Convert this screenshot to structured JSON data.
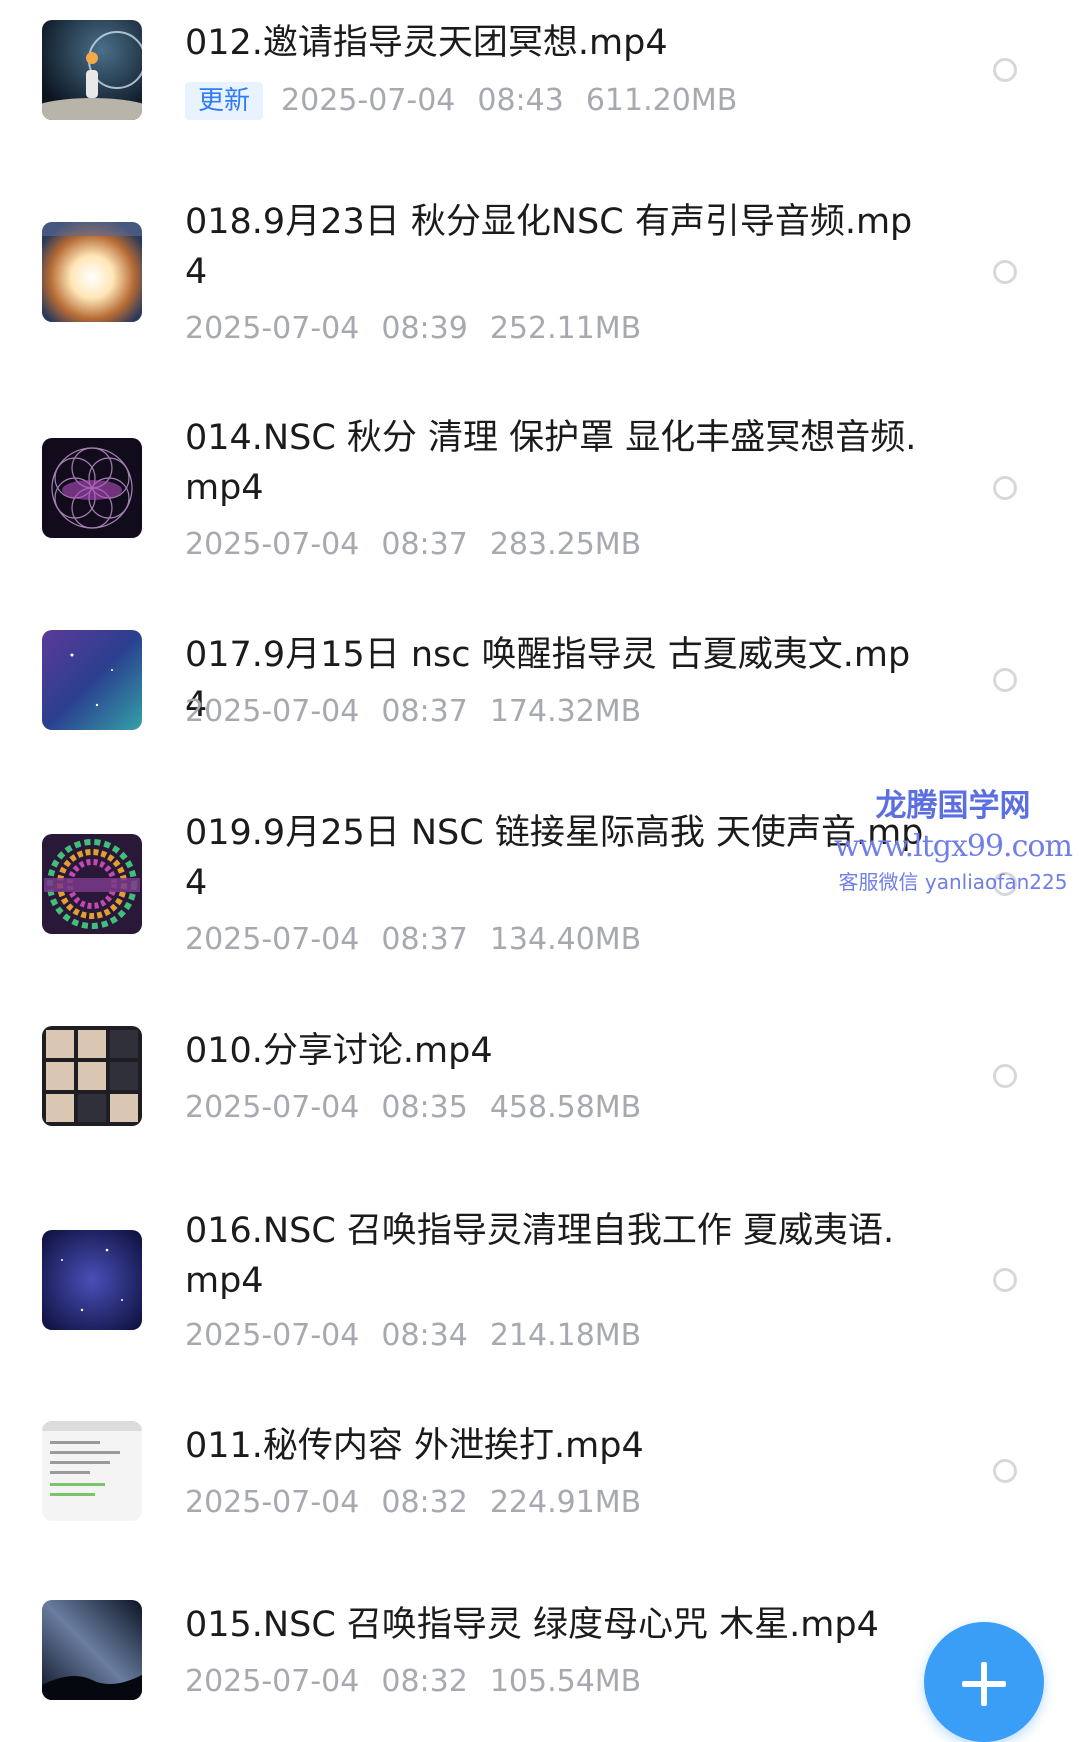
{
  "colors": {
    "accent": "#3a9df6",
    "badge_text": "#2f7cf6",
    "badge_bg": "#e9f3ff",
    "meta_text": "#a7a9b0",
    "watermark": "#6f7ee8"
  },
  "files": [
    {
      "name": "012.邀请指导灵天团冥想.mp4",
      "badge": "更新",
      "date": "2025-07-04",
      "time": "08:43",
      "size": "611.20MB",
      "thumb": "astronaut-moon-icon"
    },
    {
      "name": "018.9月23日 秋分显化NSC 有声引导音频.mp4",
      "badge": "",
      "date": "2025-07-04",
      "time": "08:39",
      "size": "252.11MB",
      "thumb": "cosmic-light-icon"
    },
    {
      "name": "014.NSC 秋分 清理 保护罩 显化丰盛冥想音频.mp4",
      "badge": "",
      "date": "2025-07-04",
      "time": "08:37",
      "size": "283.25MB",
      "thumb": "sacred-geometry-icon"
    },
    {
      "name": "017.9月15日 nsc 唤醒指导灵 古夏威夷文.mp4",
      "badge": "",
      "date": "2025-07-04",
      "time": "08:37",
      "size": "174.32MB",
      "thumb": "nebula-icon"
    },
    {
      "name": "019.9月25日 NSC 链接星际高我 天使声音.mp4",
      "badge": "",
      "date": "2025-07-04",
      "time": "08:37",
      "size": "134.40MB",
      "thumb": "mandala-icon"
    },
    {
      "name": "010.分享讨论.mp4",
      "badge": "",
      "date": "2025-07-04",
      "time": "08:35",
      "size": "458.58MB",
      "thumb": "video-call-grid-icon"
    },
    {
      "name": "016.NSC 召唤指导灵清理自我工作 夏威夷语.mp4",
      "badge": "",
      "date": "2025-07-04",
      "time": "08:34",
      "size": "214.18MB",
      "thumb": "starfield-icon"
    },
    {
      "name": "011.秘传内容 外泄挨打.mp4",
      "badge": "",
      "date": "2025-07-04",
      "time": "08:32",
      "size": "224.91MB",
      "thumb": "document-screen-icon"
    },
    {
      "name": "015.NSC 召唤指导灵 绿度母心咒 木星.mp4",
      "badge": "",
      "date": "2025-07-04",
      "time": "08:32",
      "size": "105.54MB",
      "thumb": "milky-way-icon"
    }
  ],
  "watermark": {
    "title": "龙腾国学网",
    "url": "www.ltgx99.com",
    "contact": "客服微信 yanliaofan225"
  },
  "fab": {
    "icon": "plus-icon"
  }
}
